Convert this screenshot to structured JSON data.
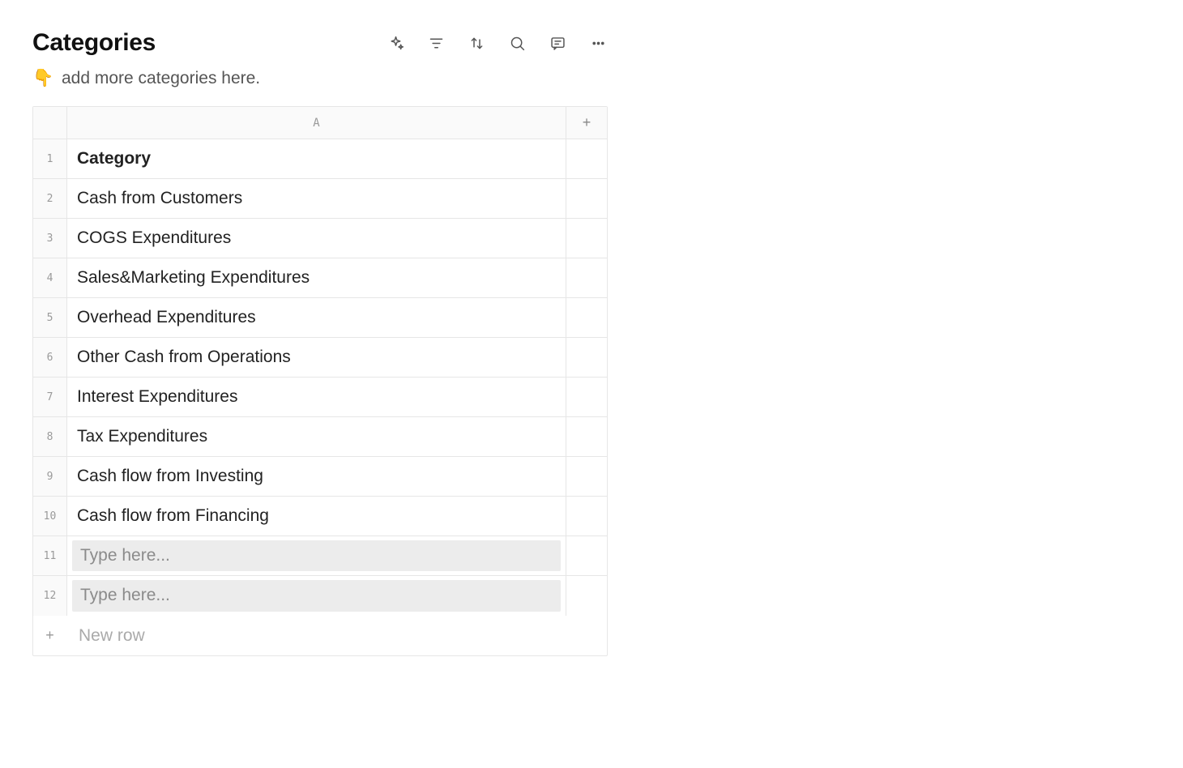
{
  "title": "Categories",
  "subtitle_emoji": "👇",
  "subtitle_text": "add more categories here.",
  "column_header": "A",
  "add_column_label": "+",
  "rows": [
    {
      "num": "1",
      "value": "Category",
      "bold": true
    },
    {
      "num": "2",
      "value": "Cash from Customers"
    },
    {
      "num": "3",
      "value": "COGS Expenditures"
    },
    {
      "num": "4",
      "value": "Sales&Marketing Expenditures"
    },
    {
      "num": "5",
      "value": "Overhead Expenditures"
    },
    {
      "num": "6",
      "value": "Other Cash from Operations"
    },
    {
      "num": "7",
      "value": "Interest Expenditures"
    },
    {
      "num": "8",
      "value": "Tax Expenditures"
    },
    {
      "num": "9",
      "value": "Cash flow from Investing"
    },
    {
      "num": "10",
      "value": "Cash flow from Financing"
    }
  ],
  "empty_rows": [
    {
      "num": "11",
      "placeholder": "Type here..."
    },
    {
      "num": "12",
      "placeholder": "Type here..."
    }
  ],
  "new_row_label": "New row",
  "new_row_icon": "+"
}
